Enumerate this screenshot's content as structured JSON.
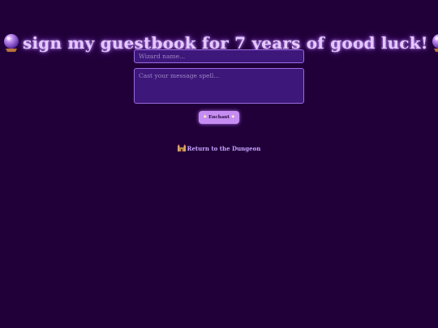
{
  "guestbook": {
    "title": "sign my guestbook for 7 years of good luck!",
    "title_icon": "crystal-ball-icon",
    "name_placeholder": "Wizard name...",
    "message_placeholder": "Cast your message spell...",
    "submit_label": "Enchant",
    "submit_icon": "sparkles-icon",
    "return_label": "Return to the Dungeon",
    "return_icon": "castle-icon"
  },
  "colors": {
    "background": "#21003a",
    "title": "#e3c8ff",
    "field_bg": "#3d177a",
    "field_border": "#9a6ae0",
    "button": "#c58cf2",
    "link": "#caa2ff"
  }
}
